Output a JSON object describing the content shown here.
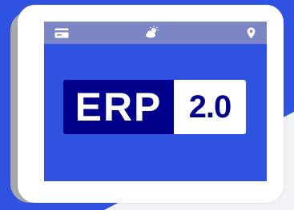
{
  "colors": {
    "background_blue": "#2f52e0",
    "screen_blue": "#2f52e0",
    "status_bar": "#7d86c4",
    "logo_dark": "#00008a",
    "device_body": "#ffffff",
    "device_shadow": "#a8a8a8"
  },
  "status_bar": {
    "icons": [
      "card-icon",
      "weather-icon",
      "location-pin-icon"
    ]
  },
  "logo": {
    "left_text": "ERP",
    "right_text": "2.0"
  }
}
